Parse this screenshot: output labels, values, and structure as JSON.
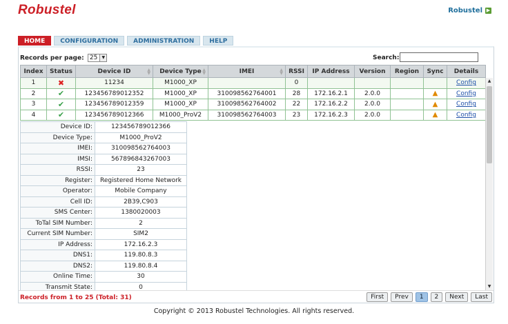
{
  "brand": "Robustel",
  "user_link": "Robustel",
  "tabs": [
    "HOME",
    "CONFIGURATION",
    "ADMINISTRATION",
    "HELP"
  ],
  "toolbar": {
    "rpp_label": "Records per page:",
    "rpp_value": "25",
    "search_label": "Search:",
    "search_value": ""
  },
  "columns": [
    "Index",
    "Status",
    "Device ID",
    "Device Type",
    "IMEI",
    "RSSI",
    "IP Address",
    "Version",
    "Region",
    "Sync",
    "Details"
  ],
  "rows": [
    {
      "index": "1",
      "status": "fail",
      "device_id": "11234",
      "device_type": "M1000_XP",
      "imei": "",
      "rssi": "0",
      "ip": "",
      "version": "",
      "region": "",
      "sync": "",
      "details": "Config"
    },
    {
      "index": "2",
      "status": "ok",
      "device_id": "123456789012352",
      "device_type": "M1000_XP",
      "imei": "310098562764001",
      "rssi": "28",
      "ip": "172.16.2.1",
      "version": "2.0.0",
      "region": "",
      "sync": "warning",
      "details": "Config"
    },
    {
      "index": "3",
      "status": "ok",
      "device_id": "123456789012359",
      "device_type": "M1000_XP",
      "imei": "310098562764002",
      "rssi": "22",
      "ip": "172.16.2.2",
      "version": "2.0.0",
      "region": "",
      "sync": "warning",
      "details": "Config"
    },
    {
      "index": "4",
      "status": "ok",
      "device_id": "123456789012366",
      "device_type": "M1000_ProV2",
      "imei": "310098562764003",
      "rssi": "23",
      "ip": "172.16.2.3",
      "version": "2.0.0",
      "region": "",
      "sync": "warning",
      "details": "Config"
    }
  ],
  "detail": [
    [
      "Device ID:",
      "123456789012366"
    ],
    [
      "Device Type:",
      "M1000_ProV2"
    ],
    [
      "IMEI:",
      "310098562764003"
    ],
    [
      "IMSI:",
      "567896843267003"
    ],
    [
      "RSSI:",
      "23"
    ],
    [
      "Register:",
      "Registered Home Network"
    ],
    [
      "Operator:",
      "Mobile Company"
    ],
    [
      "Cell ID:",
      "2B39,C903"
    ],
    [
      "SMS Center:",
      "1380020003"
    ],
    [
      "ToTal SIM Number:",
      "2"
    ],
    [
      "Current SIM Number:",
      "SIM2"
    ],
    [
      "IP Address:",
      "172.16.2.3"
    ],
    [
      "DNS1:",
      "119.80.8.3"
    ],
    [
      "DNS2:",
      "119.80.8.4"
    ],
    [
      "Online Time:",
      "30"
    ],
    [
      "Transmit State:",
      "0"
    ]
  ],
  "records_text": "Records from 1 to 25 (Total: 31)",
  "pager": [
    "First",
    "Prev",
    "1",
    "2",
    "Next",
    "Last"
  ],
  "current_page": "1",
  "copyright": "Copyright © 2013 Robustel Technologies. All rights reserved.",
  "colors": {
    "brand_red": "#cc1f26",
    "ok_green": "#3aa14a",
    "link_blue": "#1d4fa8"
  },
  "icons": {
    "ok": "check-icon",
    "fail": "cross-icon",
    "warning": "warning-icon"
  }
}
